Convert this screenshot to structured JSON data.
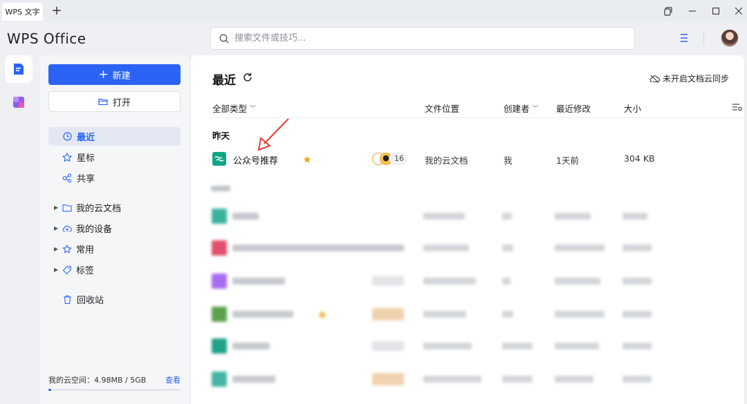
{
  "tabbar": {
    "tab_label": "WPS 文字",
    "add_label": "+"
  },
  "header": {
    "logo": "WPS Office",
    "search_placeholder": "搜索文件或技巧..."
  },
  "sidebar": {
    "new_label": "新建",
    "open_label": "打开",
    "nav": [
      {
        "label": "最近",
        "active": true
      },
      {
        "label": "星标",
        "active": false
      },
      {
        "label": "共享",
        "active": false
      }
    ],
    "tree": [
      {
        "label": "我的云文档"
      },
      {
        "label": "我的设备"
      },
      {
        "label": "常用"
      },
      {
        "label": "标签"
      }
    ],
    "trash_label": "回收站",
    "storage_label": "我的云空间：4.98MB / 5GB",
    "storage_view": "查看",
    "storage_used_fraction": 0.001
  },
  "main": {
    "title": "最近",
    "cloud_sync": "未开启文档云同步",
    "columns": {
      "type": "全部类型",
      "location": "文件位置",
      "creator": "创建者",
      "modified": "最近修改",
      "size": "大小"
    },
    "group_label": "昨天",
    "rows": [
      {
        "name": "公众号推荐",
        "starred": true,
        "collab_count": "16",
        "location": "我的云文档",
        "creator": "我",
        "modified": "1天前",
        "size": "304 KB"
      }
    ]
  },
  "colors": {
    "accent": "#2b64f5",
    "doc_green": "#12a585",
    "star": "#f0a81d",
    "annotation_red": "#e53935"
  }
}
